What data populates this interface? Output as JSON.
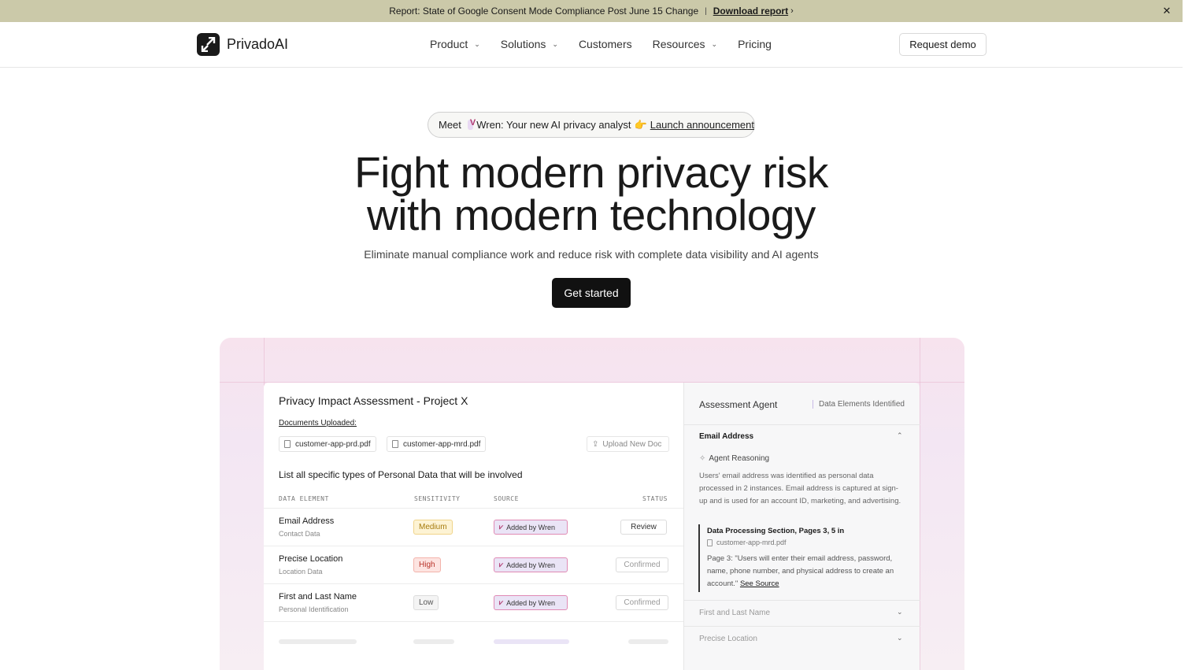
{
  "announcement": {
    "text": "Report: State of Google Consent Mode Compliance Post June 15 Change",
    "separator": "|",
    "link_label": "Download report"
  },
  "nav": {
    "brand": "PrivadoAI",
    "items": [
      {
        "label": "Product",
        "has_dropdown": true
      },
      {
        "label": "Solutions",
        "has_dropdown": true
      },
      {
        "label": "Customers",
        "has_dropdown": false
      },
      {
        "label": "Resources",
        "has_dropdown": true
      },
      {
        "label": "Pricing",
        "has_dropdown": false
      }
    ],
    "demo_button": "Request demo"
  },
  "hero": {
    "pill": {
      "meet": "Meet",
      "text": "Wren: Your new AI privacy analyst",
      "emoji": "👉",
      "link": "Launch announcement"
    },
    "headline_line1": "Fight modern privacy risk",
    "headline_line2": "with modern technology",
    "subheadline": "Eliminate manual compliance work and reduce risk with complete data visibility and AI agents",
    "cta": "Get started"
  },
  "assessment": {
    "title": "Privacy Impact Assessment - Project X",
    "docs_label": "Documents Uploaded:",
    "documents": [
      "customer-app-prd.pdf",
      "customer-app-mrd.pdf"
    ],
    "upload_label": "Upload New Doc",
    "question": "List all specific types of Personal Data that will be involved",
    "columns": [
      "DATA ELEMENT",
      "SENSITIVITY",
      "SOURCE",
      "STATUS"
    ],
    "rows": [
      {
        "name": "Email Address",
        "category": "Contact Data",
        "sensitivity": "Medium",
        "source": "Added by Wren",
        "status": "Review"
      },
      {
        "name": "Precise Location",
        "category": "Location Data",
        "sensitivity": "High",
        "source": "Added by Wren",
        "status": "Confirmed"
      },
      {
        "name": "First and Last Name",
        "category": "Personal Identification",
        "sensitivity": "Low",
        "source": "Added by Wren",
        "status": "Confirmed"
      }
    ]
  },
  "agent": {
    "title": "Assessment Agent",
    "tab": "Data Elements Identified",
    "expanded": {
      "heading": "Email Address",
      "reasoning_label": "Agent Reasoning",
      "reasoning": "Users' email address was identified as personal data processed in 2 instances. Email address is captured at sign-up and is used for an account ID, marketing, and advertising.",
      "quote_title": "Data Processing Section, Pages 3, 5 in",
      "quote_file": "customer-app-mrd.pdf",
      "quote_body": "Page 3: \"Users will enter their email address, password, name, phone number, and physical address to create an account.\"",
      "see_source": "See Source"
    },
    "collapsed": [
      "First and Last Name",
      "Precise Location"
    ]
  }
}
